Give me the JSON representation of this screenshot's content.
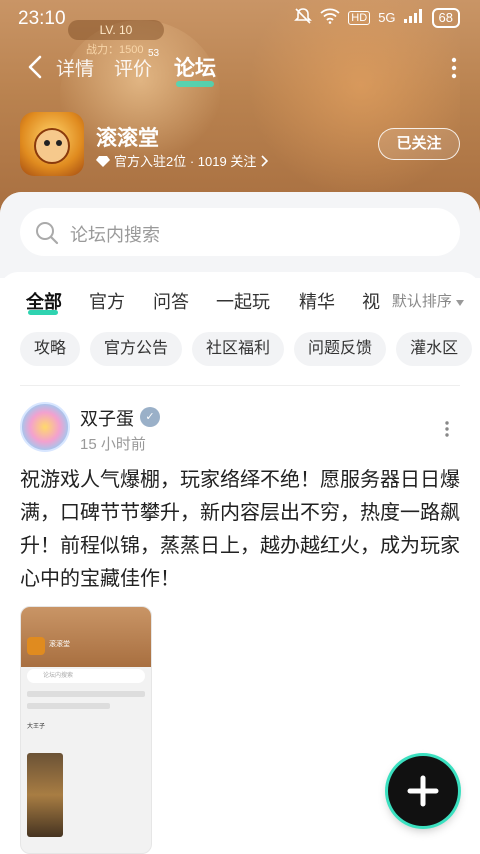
{
  "status_bar": {
    "time": "23:10",
    "hd": "HD",
    "network": "5G",
    "battery": "68"
  },
  "banner": {
    "level": "LV. 10",
    "power": "战力：1500"
  },
  "nav": {
    "tabs": [
      {
        "label": "详情"
      },
      {
        "label": "评价",
        "badge": "53"
      },
      {
        "label": "论坛",
        "active": true
      }
    ]
  },
  "game": {
    "title": "滚滚堂",
    "subtitle": "官方入驻2位 · 1019 关注",
    "follow_label": "已关注"
  },
  "search": {
    "placeholder": "论坛内搜索"
  },
  "filter_tabs": {
    "items": [
      "全部",
      "官方",
      "问答",
      "一起玩",
      "精华",
      "视"
    ],
    "sort_label": "默认排序"
  },
  "chips": [
    "攻略",
    "官方公告",
    "社区福利",
    "问题反馈",
    "灌水区"
  ],
  "post": {
    "username": "双子蛋",
    "time": "15 小时前",
    "content": "祝游戏人气爆棚，玩家络绎不绝！愿服务器日日爆满，口碑节节攀升，新内容层出不穷，热度一路飙升！前程似锦，蒸蒸日上，越办越红火，成为玩家心中的宝藏佳作！"
  },
  "thumbnail": {
    "title": "滚滚堂",
    "search": "论坛内搜索",
    "user": "大王子"
  },
  "colors": {
    "accent": "#2fd3b0",
    "banner": "#b9824f"
  }
}
